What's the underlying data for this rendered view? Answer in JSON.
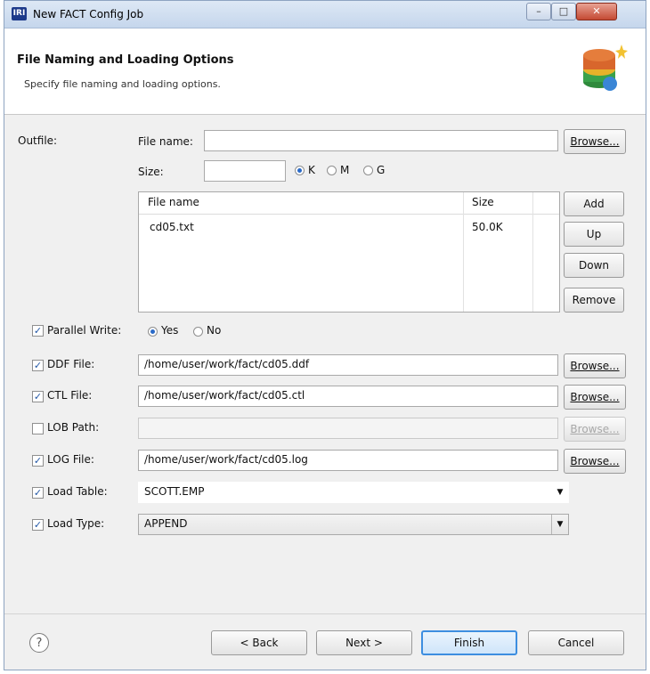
{
  "window": {
    "title": "New FACT Config Job",
    "app_icon_text": "IRI"
  },
  "header": {
    "title": "File Naming and Loading Options",
    "subtitle": "Specify file naming and loading options."
  },
  "outfile": {
    "label": "Outfile:",
    "file_name_label": "File name:",
    "file_name_value": "",
    "browse_label": "Browse...",
    "size_label": "Size:",
    "size_value": "",
    "size_units": [
      "K",
      "M",
      "G"
    ],
    "size_unit_selected": "K"
  },
  "file_table": {
    "columns": [
      "File name",
      "Size"
    ],
    "rows": [
      {
        "file_name": "cd05.txt",
        "size": "50.0K"
      }
    ]
  },
  "table_buttons": {
    "add": "Add",
    "up": "Up",
    "down": "Down",
    "remove": "Remove"
  },
  "parallel_write": {
    "label": "Parallel Write:",
    "checked": true,
    "options": [
      "Yes",
      "No"
    ],
    "selected": "Yes"
  },
  "ddf_file": {
    "label": "DDF File:",
    "checked": true,
    "value": "/home/user/work/fact/cd05.ddf",
    "browse_label": "Browse..."
  },
  "ctl_file": {
    "label": "CTL File:",
    "checked": true,
    "value": "/home/user/work/fact/cd05.ctl",
    "browse_label": "Browse..."
  },
  "lob_path": {
    "label": "LOB Path:",
    "checked": false,
    "value": "",
    "browse_label": "Browse..."
  },
  "log_file": {
    "label": "LOG File:",
    "checked": true,
    "value": "/home/user/work/fact/cd05.log",
    "browse_label": "Browse..."
  },
  "load_table": {
    "label": "Load Table:",
    "checked": true,
    "value": "SCOTT.EMP"
  },
  "load_type": {
    "label": "Load Type:",
    "checked": true,
    "value": "APPEND"
  },
  "footer": {
    "help_icon": "?",
    "back": "< Back",
    "next": "Next >",
    "finish": "Finish",
    "cancel": "Cancel"
  },
  "colors": {
    "focus_border": "#3d8ee0",
    "radio_dot": "#2a6ac8",
    "check_mark": "#2458a6"
  }
}
